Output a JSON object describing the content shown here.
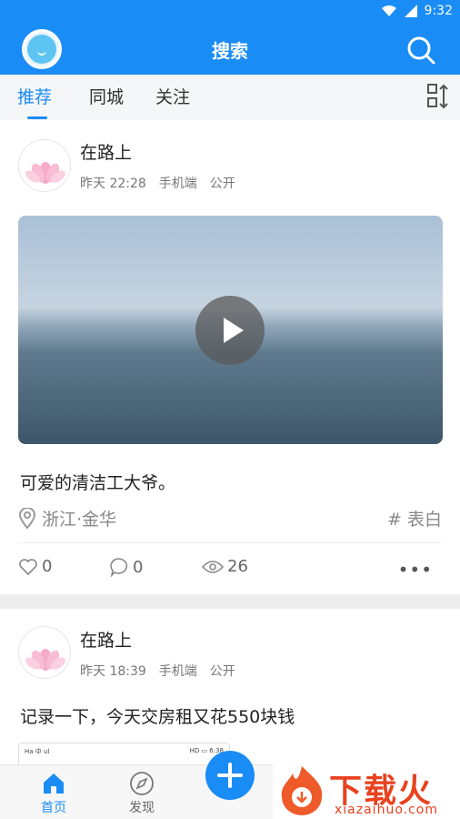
{
  "status_bar": {
    "time": "9:32",
    "icons": [
      "wifi-icon",
      "signal-icon",
      "battery-icon"
    ]
  },
  "header": {
    "title": "搜索",
    "avatar_icon": "app-avatar-icon",
    "search_icon": "search-icon"
  },
  "tabs": [
    {
      "label": "推荐",
      "active": true
    },
    {
      "label": "同城",
      "active": false
    },
    {
      "label": "关注",
      "active": false
    }
  ],
  "sort_icon": "sort-icon",
  "posts": [
    {
      "author": "在路上",
      "time": "昨天 22:28",
      "device": "手机端",
      "visibility": "公开",
      "media": "video",
      "text": "可爱的清洁工大爷。",
      "location": "浙江·金华",
      "tag": "# 表白",
      "likes": "0",
      "comments": "0",
      "views": "26"
    },
    {
      "author": "在路上",
      "time": "昨天 18:39",
      "device": "手机端",
      "visibility": "公开",
      "text": "记录一下，今天交房租又花550块钱",
      "thumb_left": "Ha 中 ul",
      "thumb_right": "HD ▭ 6:38"
    }
  ],
  "bottom_nav": [
    {
      "label": "首页",
      "icon": "home-icon",
      "active": true
    },
    {
      "label": "发现",
      "icon": "compass-icon",
      "active": false
    }
  ],
  "fab_icon": "plus-icon",
  "watermark": {
    "title": "下载火",
    "subtitle": "xiazaihuo.com"
  },
  "colors": {
    "primary": "#1a8cf6",
    "text": "#222222",
    "muted": "#888888",
    "brand_red": "#e8421f"
  }
}
